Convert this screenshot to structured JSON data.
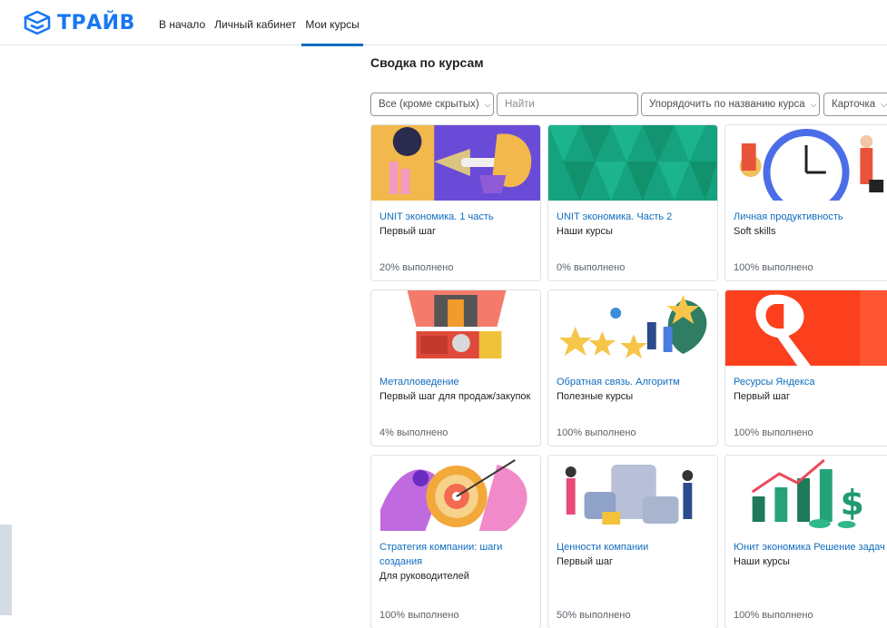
{
  "brand": {
    "name": "ТРАЙВ",
    "color": "#1877f2"
  },
  "nav": [
    {
      "label": "В начало"
    },
    {
      "label": "Личный кабинет"
    },
    {
      "label": "Мои курсы",
      "active": true
    }
  ],
  "page": {
    "section_title": "Сводка по курсам"
  },
  "filters": {
    "grouping": "Все (кроме скрытых)",
    "search_placeholder": "Найти",
    "sort": "Упорядочить по названию курса",
    "view": "Карточка"
  },
  "courses": [
    {
      "name": "UNIT экономика. 1 часть",
      "category": "Первый шаг",
      "progress": "20% выполнено",
      "image": "handshake-illustration"
    },
    {
      "name": "UNIT экономика. Часть 2",
      "category": "Наши курсы",
      "progress": "0% выполнено",
      "image": "green-pattern"
    },
    {
      "name": "Личная продуктивность",
      "category": "Soft skills",
      "progress": "100% выполнено",
      "image": "clock-illustration"
    },
    {
      "name": "Металловедение",
      "category": "Первый шаг для продаж/закупок",
      "progress": "4% выполнено",
      "image": "foundry-illustration"
    },
    {
      "name": "Обратная связь. Алгоритм",
      "category": "Полезные курсы",
      "progress": "100% выполнено",
      "image": "stars-feedback-illustration"
    },
    {
      "name": "Ресурсы Яндекса",
      "category": "Первый шаг",
      "progress": "100% выполнено",
      "image": "yandex-logo"
    },
    {
      "name": "Стратегия компании: шаги создания",
      "category": "Для руководителей",
      "progress": "100% выполнено",
      "image": "target-illustration"
    },
    {
      "name": "Ценности компании",
      "category": "Первый шаг",
      "progress": "50% выполнено",
      "image": "puzzle-illustration"
    },
    {
      "name": "Юнит экономика Решение задач",
      "category": "Наши курсы",
      "progress": "100% выполнено",
      "image": "finance-illustration"
    }
  ],
  "colors": {
    "link": "#0f6cbf",
    "border": "#dee2e6",
    "accent": "#0f6cbf"
  }
}
